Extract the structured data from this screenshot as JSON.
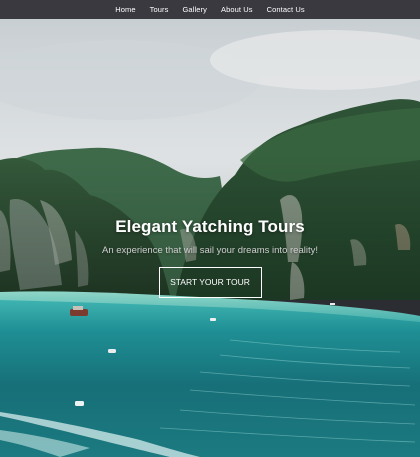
{
  "nav": {
    "items": [
      {
        "id": "home",
        "label": "Home"
      },
      {
        "id": "tours",
        "label": "Tours"
      },
      {
        "id": "gallery",
        "label": "Gallery"
      },
      {
        "id": "about",
        "label": "About Us"
      },
      {
        "id": "contact",
        "label": "Contact Us"
      }
    ]
  },
  "hero": {
    "title": "Elegant Yatching Tours",
    "subtitle": "An experience that will sail your dreams into reality!",
    "cta_label": "START YOUR TOUR"
  },
  "colors": {
    "navbar_bg": "#3a3940",
    "text_primary": "#ffffff",
    "text_subtitle": "#cfcfcf",
    "sea": "#1f8a8c",
    "sky": "#d9dde0",
    "cliff_green": "#2f5a34"
  }
}
